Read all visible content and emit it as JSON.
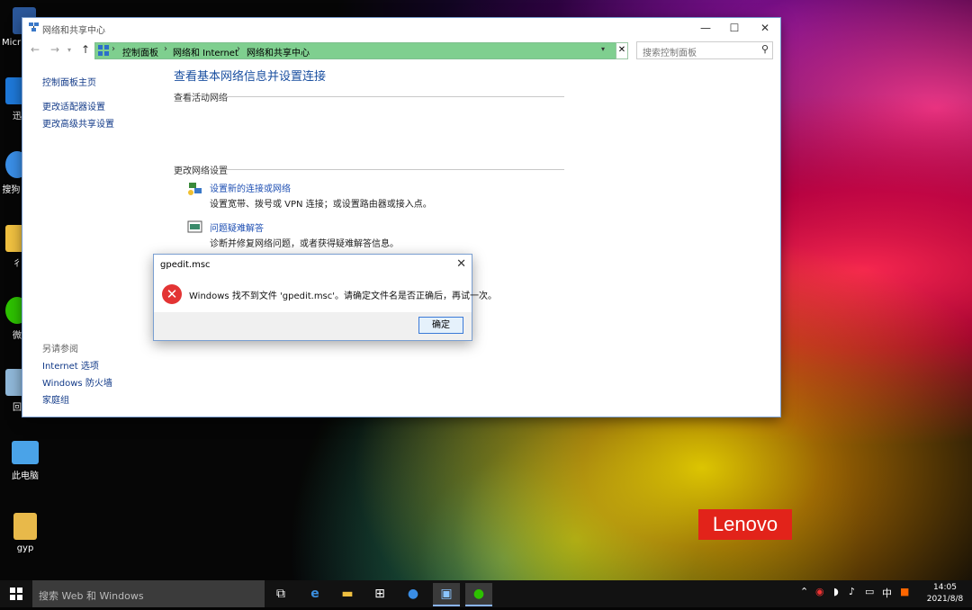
{
  "desktop": {
    "icons": [
      {
        "label": "Micr Word",
        "name": "word"
      },
      {
        "label": "迅",
        "name": "xunlei"
      },
      {
        "label": "搜狗 资",
        "name": "sogou"
      },
      {
        "label": "彳",
        "name": "folder-1"
      },
      {
        "label": "微",
        "name": "wechat"
      },
      {
        "label": "回",
        "name": "recycle-bin"
      },
      {
        "label": "此电脑",
        "name": "this-pc"
      },
      {
        "label": "gyp",
        "name": "user-folder"
      }
    ],
    "brand": "Lenovo"
  },
  "window": {
    "title": "网络和共享中心",
    "controls": {
      "minimize": "—",
      "maximize": "☐",
      "close": "✕"
    },
    "breadcrumbs": [
      "控制面板",
      "网络和 Internet",
      "网络和共享中心"
    ],
    "search_placeholder": "搜索控制面板",
    "leftnav": {
      "links": [
        "控制面板主页",
        "更改适配器设置",
        "更改高级共享设置"
      ],
      "see_also_label": "另请参阅",
      "see_also": [
        "Internet 选项",
        "Windows 防火墙",
        "家庭组"
      ]
    },
    "main": {
      "heading": "查看基本网络信息并设置连接",
      "active_networks_label": "查看活动网络",
      "change_settings_label": "更改网络设置",
      "tasks": [
        {
          "link": "设置新的连接或网络",
          "desc": "设置宽带、拨号或 VPN 连接；或设置路由器或接入点。"
        },
        {
          "link": "问题疑难解答",
          "desc": "诊断并修复网络问题，或者获得疑难解答信息。"
        }
      ]
    }
  },
  "dialog": {
    "title": "gpedit.msc",
    "message": "Windows 找不到文件 'gpedit.msc'。请确定文件名是否正确后，再试一次。",
    "ok_label": "确定"
  },
  "taskbar": {
    "search_placeholder": "搜索 Web 和 Windows",
    "tray_lang": "中",
    "time": "14:05",
    "date": "2021/8/8"
  },
  "colors": {
    "address_bar": "#7fcf8f",
    "link": "#1e4fb3",
    "lenovo": "#e2231a",
    "error": "#e33434"
  }
}
